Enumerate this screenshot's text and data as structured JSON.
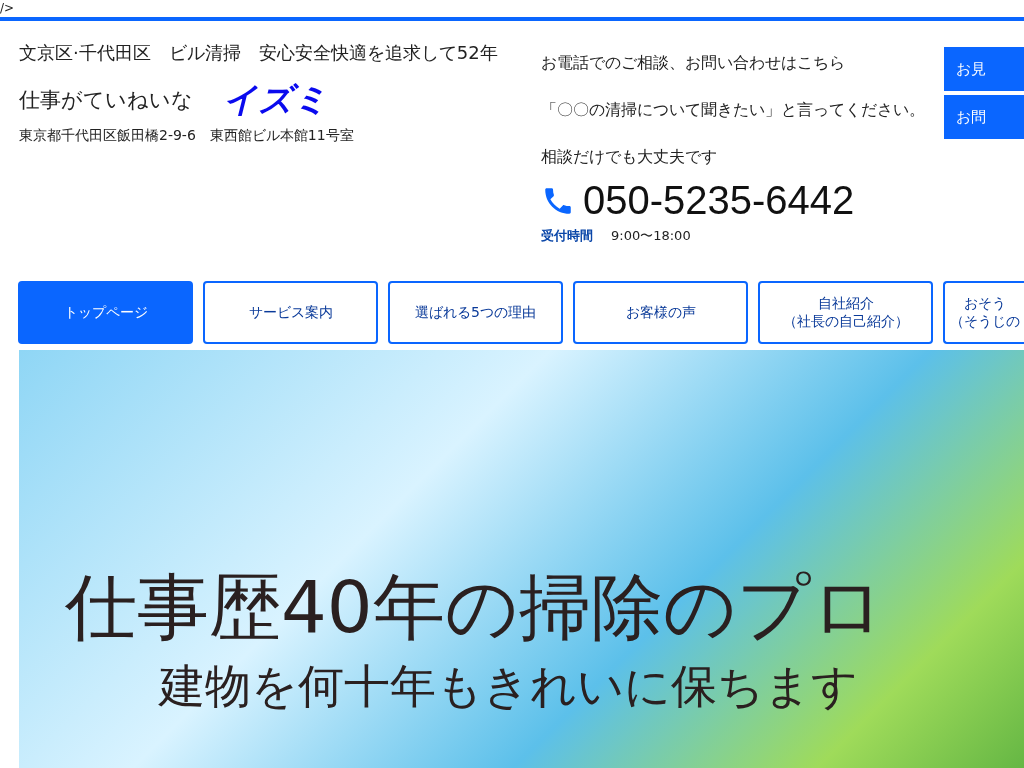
{
  "stray_markup": "/>",
  "header": {
    "tagline": "文京区·千代田区　ビル清掃　安心安全快適を追求して52年",
    "catch": "仕事がていねいな",
    "brand": "イズミ",
    "address": "東京都千代田区飯田橋2-9-6　東西館ビル本館11号室"
  },
  "contact": {
    "lines": [
      "お電話でのご相談、お問い合わせはこちら",
      "「〇〇の清掃について聞きたい」と言ってください。",
      "相談だけでも大丈夫です"
    ],
    "phone": "050-5235-6442",
    "hours_label": "受付時間",
    "hours": "9:00〜18:00"
  },
  "side_buttons": [
    "お見",
    "お問"
  ],
  "nav": [
    {
      "label": "トップページ",
      "selected": true
    },
    {
      "label": "サービス案内",
      "selected": false
    },
    {
      "label": "選ばれる5つの理由",
      "selected": false
    },
    {
      "label": "お客様の声",
      "selected": false
    },
    {
      "lines": [
        "自社紹介",
        "（社長の自己紹介）"
      ],
      "selected": false
    },
    {
      "lines": [
        "おそう",
        "（そうじの"
      ],
      "selected": false
    }
  ],
  "hero": {
    "headline": "仕事歴40年の掃除のプロ",
    "subline": "建物を何十年もきれいに保ちます"
  }
}
